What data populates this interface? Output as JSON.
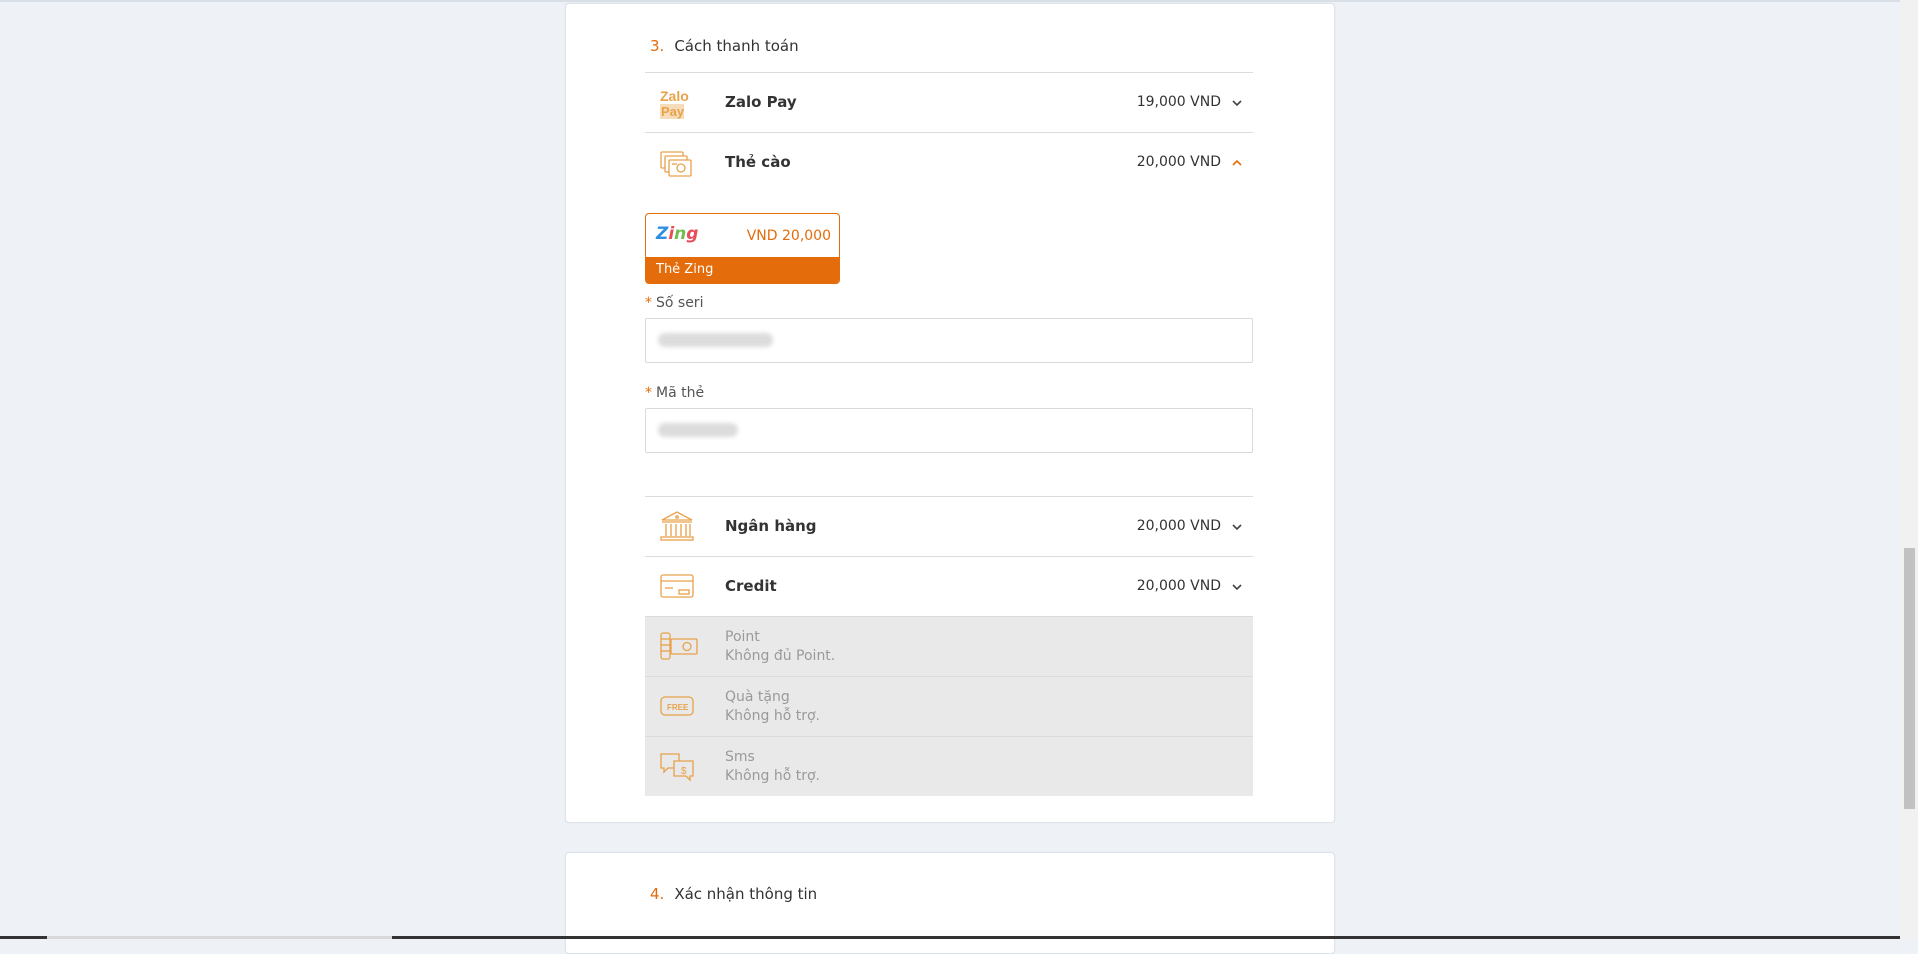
{
  "section3": {
    "number": "3.",
    "title": "Cách thanh toán"
  },
  "methods": [
    {
      "name": "Zalo Pay",
      "price": "19,000 VND",
      "icon": "zalopay-icon",
      "expanded": false
    },
    {
      "name": "Thẻ cào",
      "price": "20,000 VND",
      "icon": "scratch-card-icon",
      "expanded": true
    },
    {
      "name": "Ngân hàng",
      "price": "20,000 VND",
      "icon": "bank-icon",
      "expanded": false
    },
    {
      "name": "Credit",
      "price": "20,000 VND",
      "icon": "credit-card-icon",
      "expanded": false
    }
  ],
  "disabled_methods": [
    {
      "name": "Point",
      "note": "Không đủ Point.",
      "icon": "coins-icon"
    },
    {
      "name": "Quà tặng",
      "note": "Không hỗ trợ.",
      "icon": "free-gift-icon"
    },
    {
      "name": "Sms",
      "note": "Không hỗ trợ.",
      "icon": "sms-icon"
    }
  ],
  "zing_card": {
    "logo": "Zing",
    "amount": "VND 20,000",
    "label": "Thẻ Zing"
  },
  "fields": {
    "serial": {
      "label": "Số seri",
      "required_mark": "*"
    },
    "code": {
      "label": "Mã thẻ",
      "required_mark": "*"
    }
  },
  "section4": {
    "number": "4.",
    "title": "Xác nhận thông tin"
  },
  "colors": {
    "accent": "#e46c0a",
    "icon": "#e8a24c",
    "disabled_bg": "#e9e9e9"
  },
  "zalopay_logo": {
    "line1": "Zalo",
    "line2": "Pay"
  },
  "free_badge": "FREE"
}
